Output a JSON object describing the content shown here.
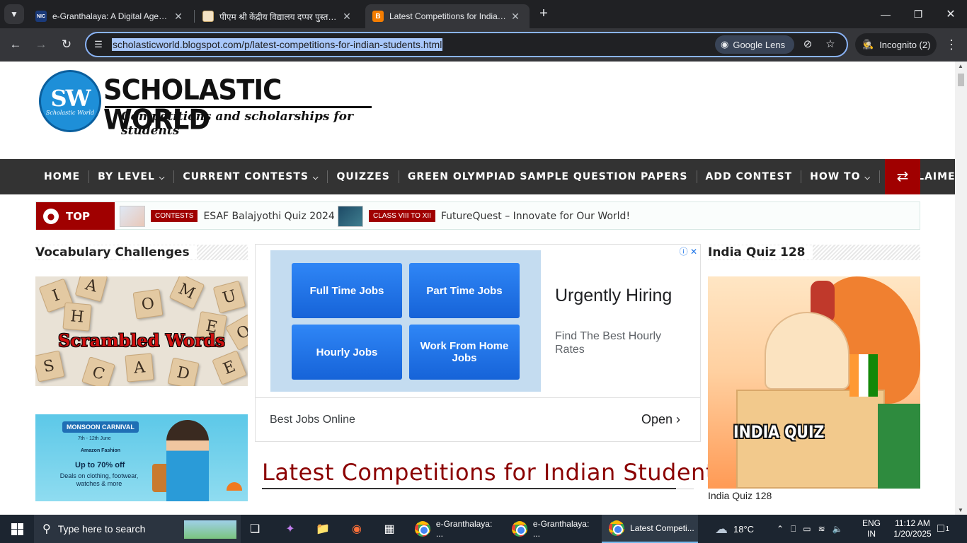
{
  "browser": {
    "tabs": [
      {
        "title": "e-Granthalaya: A Digital Agenda",
        "favicon": "NIC"
      },
      {
        "title": "पीएम श्री केंद्रीय विद्यालय दप्पर पुस्तकालय",
        "favicon": ""
      },
      {
        "title": "Latest Competitions for Indian Students",
        "favicon": "B"
      }
    ],
    "url": "scholasticworld.blogspot.com/p/latest-competitions-for-indian-students.html",
    "lens_label": "Google Lens",
    "profile_label": "Incognito (2)",
    "icons": {
      "tab_search": "chevron-down-icon",
      "new_tab": "plus-icon",
      "back": "arrow-left-icon",
      "forward": "arrow-right-icon",
      "reload": "reload-icon",
      "site_info": "tune-icon",
      "eye_off": "eye-off-icon",
      "bookmark": "star-icon",
      "menu": "kebab-menu-icon"
    }
  },
  "site": {
    "logo_badge": "SW",
    "logo_badge_small": "Scholastic World",
    "logo_title": "SCHOLASTIC WORLD",
    "logo_tagline": "Competitions and scholarships for students",
    "nav": [
      "HOME",
      "BY LEVEL",
      "CURRENT CONTESTS",
      "QUIZZES",
      "GREEN OLYMPIAD SAMPLE QUESTION PAPERS",
      "ADD CONTEST",
      "HOW TO",
      "DISCLAIMER"
    ],
    "ticker_label": "TOP",
    "ticker": [
      {
        "tag": "CONTESTS",
        "text": "ESAF Balajyothi Quiz 2024"
      },
      {
        "tag": "CLASS VIII TO XII",
        "text": "FutureQuest – Innovate for Our World!"
      }
    ],
    "left_widget_title": "Vocabulary Challenges",
    "scramble_label": "Scrambled Words",
    "monsoon": {
      "pill": "MONSOON CARNIVAL",
      "dates": "7th - 12th June",
      "brand": "Amazon Fashion",
      "offer": "Up to 70% off",
      "desc": "Deals on clothing, footwear, watches & more"
    },
    "ad": {
      "buttons": [
        "Full Time Jobs",
        "Part Time Jobs",
        "Hourly Jobs",
        "Work From Home Jobs"
      ],
      "headline": "Urgently Hiring",
      "sub": "Find The Best Hourly Rates",
      "footer_left": "Best Jobs Online",
      "footer_right": "Open"
    },
    "post_title": "Latest Competitions for Indian Students",
    "right_widget_title": "India Quiz 128",
    "india_quiz_label": "INDIA QUIZ",
    "india_quiz_caption": "India Quiz 128"
  },
  "taskbar": {
    "search_placeholder": "Type here to search",
    "apps": [
      {
        "label": "e-Granthalaya: ..."
      },
      {
        "label": "e-Granthalaya: ..."
      },
      {
        "label": "Latest Competi..."
      }
    ],
    "weather": "18°C",
    "lang_top": "ENG",
    "lang_bottom": "IN",
    "time": "11:12 AM",
    "date": "1/20/2025",
    "notif_count": "1"
  },
  "colors": {
    "accent_red": "#a00000",
    "nav_bg": "#333333",
    "chrome_dark": "#202124",
    "url_highlight": "#a8c7fa"
  }
}
